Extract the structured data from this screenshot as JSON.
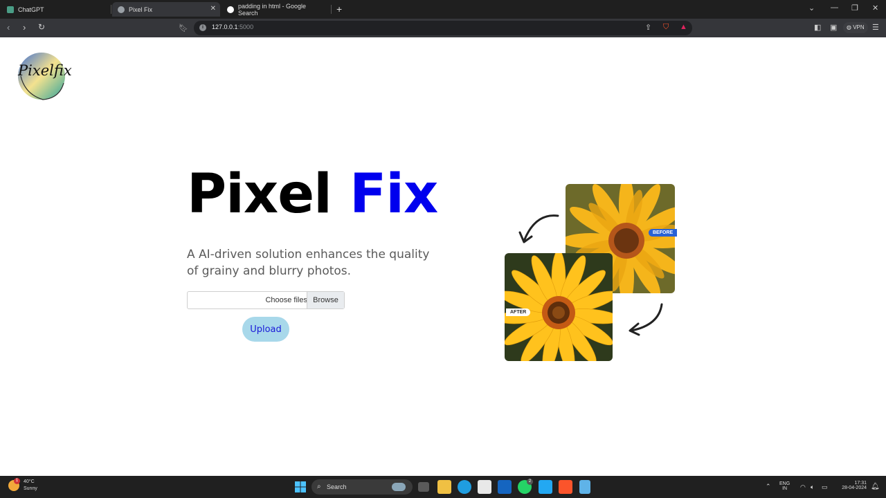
{
  "browser": {
    "tabs": [
      {
        "title": "ChatGPT",
        "favicon": "chatgpt-icon"
      },
      {
        "title": "Pixel Fix",
        "favicon": "globe-icon"
      },
      {
        "title": "padding in html - Google Search",
        "favicon": "google-icon"
      }
    ],
    "active_tab": 1,
    "url_host": "127.0.0.1",
    "url_port": ":5000",
    "vpn_label": "VPN"
  },
  "page": {
    "logo_text": "Pixelfix",
    "title_part1": "Pixel",
    "title_part2": "Fix",
    "tagline": "A AI-driven solution enhances the quality of grainy and blurry photos.",
    "file_input_label": "Choose files",
    "browse_label": "Browse",
    "upload_label": "Upload",
    "before_tag": "BEFORE",
    "after_tag": "AFTER",
    "colors": {
      "title_accent": "#0000ee",
      "upload_bg": "#a8d8ea",
      "upload_text": "#1a1ad8"
    }
  },
  "taskbar": {
    "weather_temp": "40°C",
    "weather_desc": "Sunny",
    "weather_badge": "1",
    "search_placeholder": "Search",
    "whatsapp_badge": "2",
    "lang_line1": "ENG",
    "lang_line2": "IN",
    "time": "17:31",
    "date": "28-04-2024"
  }
}
